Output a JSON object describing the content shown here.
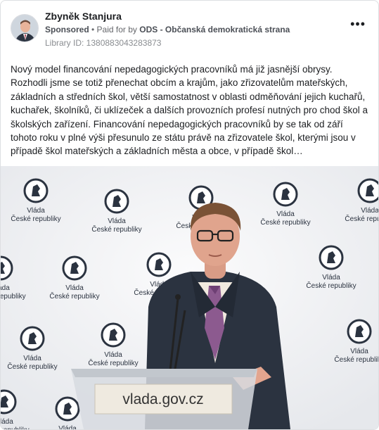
{
  "post": {
    "author": "Zbyněk Stanjura",
    "sponsored": "Sponsored",
    "separator": " • ",
    "paid_by_prefix": "Paid for by ",
    "paid_by": "ODS - Občanská demokratická strana",
    "library_id": "Library ID: 1380883043283873",
    "menu_icon": "more-options-icon",
    "menu_label": "•••",
    "text": "Nový model financování nepedagogických pracovníků má již jasnější obrysy. Rozhodli jsme se totiž přenechat obcím a krajům, jako zřizovatelům mateřských, základních a středních škol, větší samostatnost v oblasti odměňování jejich kuchařů, kuchařek, školníků, či uklízeček a dalších provozních profesí nutných pro chod škol a školských zařízení. Financování nepedagogických pracovníků by se tak od září tohoto roku v plné výši přesunulo ze státu právě na zřizovatele škol, kterými jsou v případě škol mateřských a základních města a obce, v případě škol…"
  },
  "photo": {
    "backdrop_logo_line1": "Vláda",
    "backdrop_logo_line2": "České republiky",
    "podium_text": "vlada.gov.cz"
  },
  "colors": {
    "card_border": "#dddfe2",
    "secondary_text": "#65676b",
    "suit": "#2b3340",
    "backdrop": "#f4f5f7"
  }
}
